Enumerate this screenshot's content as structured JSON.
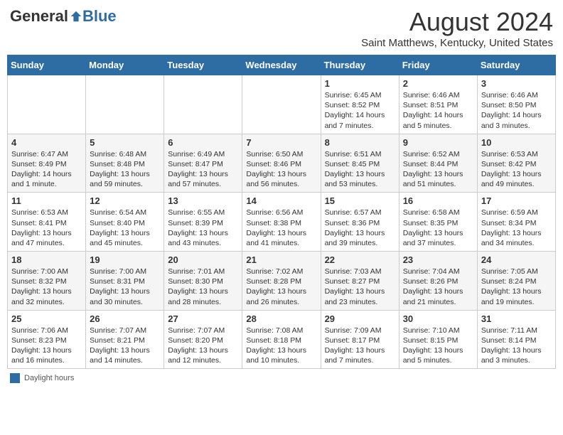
{
  "header": {
    "logo_general": "General",
    "logo_blue": "Blue",
    "month": "August 2024",
    "location": "Saint Matthews, Kentucky, United States"
  },
  "days_of_week": [
    "Sunday",
    "Monday",
    "Tuesday",
    "Wednesday",
    "Thursday",
    "Friday",
    "Saturday"
  ],
  "weeks": [
    {
      "cells": [
        {
          "day": "",
          "content": ""
        },
        {
          "day": "",
          "content": ""
        },
        {
          "day": "",
          "content": ""
        },
        {
          "day": "",
          "content": ""
        },
        {
          "day": "1",
          "content": "Sunrise: 6:45 AM\nSunset: 8:52 PM\nDaylight: 14 hours\nand 7 minutes."
        },
        {
          "day": "2",
          "content": "Sunrise: 6:46 AM\nSunset: 8:51 PM\nDaylight: 14 hours\nand 5 minutes."
        },
        {
          "day": "3",
          "content": "Sunrise: 6:46 AM\nSunset: 8:50 PM\nDaylight: 14 hours\nand 3 minutes."
        }
      ]
    },
    {
      "cells": [
        {
          "day": "4",
          "content": "Sunrise: 6:47 AM\nSunset: 8:49 PM\nDaylight: 14 hours\nand 1 minute."
        },
        {
          "day": "5",
          "content": "Sunrise: 6:48 AM\nSunset: 8:48 PM\nDaylight: 13 hours\nand 59 minutes."
        },
        {
          "day": "6",
          "content": "Sunrise: 6:49 AM\nSunset: 8:47 PM\nDaylight: 13 hours\nand 57 minutes."
        },
        {
          "day": "7",
          "content": "Sunrise: 6:50 AM\nSunset: 8:46 PM\nDaylight: 13 hours\nand 56 minutes."
        },
        {
          "day": "8",
          "content": "Sunrise: 6:51 AM\nSunset: 8:45 PM\nDaylight: 13 hours\nand 53 minutes."
        },
        {
          "day": "9",
          "content": "Sunrise: 6:52 AM\nSunset: 8:44 PM\nDaylight: 13 hours\nand 51 minutes."
        },
        {
          "day": "10",
          "content": "Sunrise: 6:53 AM\nSunset: 8:42 PM\nDaylight: 13 hours\nand 49 minutes."
        }
      ]
    },
    {
      "cells": [
        {
          "day": "11",
          "content": "Sunrise: 6:53 AM\nSunset: 8:41 PM\nDaylight: 13 hours\nand 47 minutes."
        },
        {
          "day": "12",
          "content": "Sunrise: 6:54 AM\nSunset: 8:40 PM\nDaylight: 13 hours\nand 45 minutes."
        },
        {
          "day": "13",
          "content": "Sunrise: 6:55 AM\nSunset: 8:39 PM\nDaylight: 13 hours\nand 43 minutes."
        },
        {
          "day": "14",
          "content": "Sunrise: 6:56 AM\nSunset: 8:38 PM\nDaylight: 13 hours\nand 41 minutes."
        },
        {
          "day": "15",
          "content": "Sunrise: 6:57 AM\nSunset: 8:36 PM\nDaylight: 13 hours\nand 39 minutes."
        },
        {
          "day": "16",
          "content": "Sunrise: 6:58 AM\nSunset: 8:35 PM\nDaylight: 13 hours\nand 37 minutes."
        },
        {
          "day": "17",
          "content": "Sunrise: 6:59 AM\nSunset: 8:34 PM\nDaylight: 13 hours\nand 34 minutes."
        }
      ]
    },
    {
      "cells": [
        {
          "day": "18",
          "content": "Sunrise: 7:00 AM\nSunset: 8:32 PM\nDaylight: 13 hours\nand 32 minutes."
        },
        {
          "day": "19",
          "content": "Sunrise: 7:00 AM\nSunset: 8:31 PM\nDaylight: 13 hours\nand 30 minutes."
        },
        {
          "day": "20",
          "content": "Sunrise: 7:01 AM\nSunset: 8:30 PM\nDaylight: 13 hours\nand 28 minutes."
        },
        {
          "day": "21",
          "content": "Sunrise: 7:02 AM\nSunset: 8:28 PM\nDaylight: 13 hours\nand 26 minutes."
        },
        {
          "day": "22",
          "content": "Sunrise: 7:03 AM\nSunset: 8:27 PM\nDaylight: 13 hours\nand 23 minutes."
        },
        {
          "day": "23",
          "content": "Sunrise: 7:04 AM\nSunset: 8:26 PM\nDaylight: 13 hours\nand 21 minutes."
        },
        {
          "day": "24",
          "content": "Sunrise: 7:05 AM\nSunset: 8:24 PM\nDaylight: 13 hours\nand 19 minutes."
        }
      ]
    },
    {
      "cells": [
        {
          "day": "25",
          "content": "Sunrise: 7:06 AM\nSunset: 8:23 PM\nDaylight: 13 hours\nand 16 minutes."
        },
        {
          "day": "26",
          "content": "Sunrise: 7:07 AM\nSunset: 8:21 PM\nDaylight: 13 hours\nand 14 minutes."
        },
        {
          "day": "27",
          "content": "Sunrise: 7:07 AM\nSunset: 8:20 PM\nDaylight: 13 hours\nand 12 minutes."
        },
        {
          "day": "28",
          "content": "Sunrise: 7:08 AM\nSunset: 8:18 PM\nDaylight: 13 hours\nand 10 minutes."
        },
        {
          "day": "29",
          "content": "Sunrise: 7:09 AM\nSunset: 8:17 PM\nDaylight: 13 hours\nand 7 minutes."
        },
        {
          "day": "30",
          "content": "Sunrise: 7:10 AM\nSunset: 8:15 PM\nDaylight: 13 hours\nand 5 minutes."
        },
        {
          "day": "31",
          "content": "Sunrise: 7:11 AM\nSunset: 8:14 PM\nDaylight: 13 hours\nand 3 minutes."
        }
      ]
    }
  ],
  "footer": {
    "legend_label": "Daylight hours"
  }
}
